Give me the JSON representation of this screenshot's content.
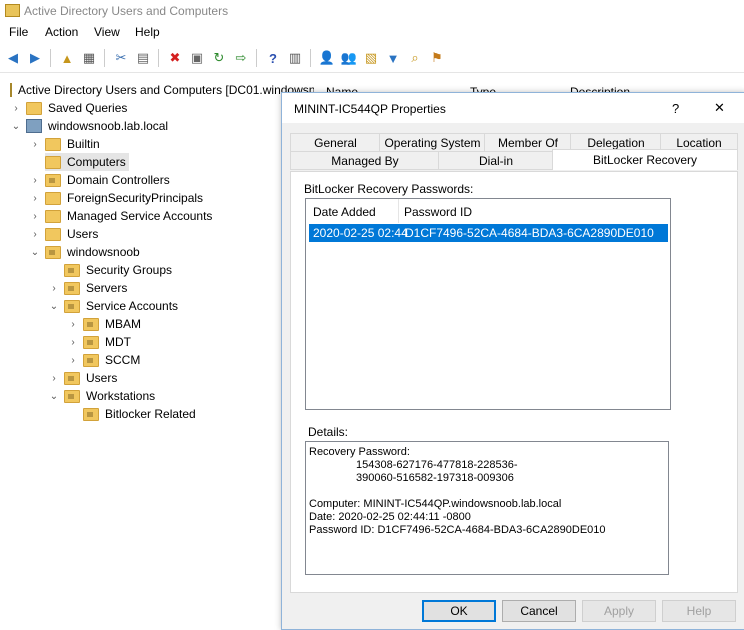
{
  "window": {
    "title": "Active Directory Users and Computers"
  },
  "menu": [
    "File",
    "Action",
    "View",
    "Help"
  ],
  "toolbar_icons": [
    "back-arrow-icon",
    "forward-arrow-icon",
    "up-folder-icon",
    "show-hide-tree-icon",
    "cut-icon",
    "clipboard-icon",
    "delete-icon",
    "properties-icon",
    "refresh-icon",
    "export-icon",
    "help-icon",
    "console-help-icon",
    "new-user-icon",
    "new-group-icon",
    "new-ou-icon",
    "filter-icon",
    "find-icon",
    "add-to-group-icon"
  ],
  "tree": {
    "root": "Active Directory Users and Computers [DC01.windowsnoob.lab.local]",
    "saved_queries": "Saved Queries",
    "domain": "windowsnoob.lab.local",
    "items": [
      {
        "label": "Builtin",
        "level": 2
      },
      {
        "label": "Computers",
        "level": 2,
        "selected": true
      },
      {
        "label": "Domain Controllers",
        "level": 2
      },
      {
        "label": "ForeignSecurityPrincipals",
        "level": 2
      },
      {
        "label": "Managed Service Accounts",
        "level": 2
      },
      {
        "label": "Users",
        "level": 2
      },
      {
        "label": "windowsnoob",
        "level": 2
      },
      {
        "label": "Security Groups",
        "level": 3
      },
      {
        "label": "Servers",
        "level": 3
      },
      {
        "label": "Service Accounts",
        "level": 3
      },
      {
        "label": "MBAM",
        "level": 4
      },
      {
        "label": "MDT",
        "level": 4
      },
      {
        "label": "SCCM",
        "level": 4
      },
      {
        "label": "Users",
        "level": 3
      },
      {
        "label": "Workstations",
        "level": 3
      },
      {
        "label": "Bitlocker Related",
        "level": 4
      }
    ]
  },
  "list_header": {
    "name": "Name",
    "type": "Type",
    "description": "Description"
  },
  "dialog": {
    "title": "MININT-IC544QP Properties",
    "help_symbol": "?",
    "close_symbol": "✕",
    "tabs_row1": [
      "General",
      "Operating System",
      "Member Of",
      "Delegation",
      "Location"
    ],
    "tabs_row2": [
      "Managed By",
      "Dial-in",
      "BitLocker Recovery"
    ],
    "active_tab": "BitLocker Recovery",
    "passwords_label": "BitLocker Recovery Passwords:",
    "columns": {
      "date": "Date Added",
      "id": "Password ID"
    },
    "rows": [
      {
        "date": "2020-02-25 02:44",
        "id": "D1CF7496-52CA-4684-BDA3-6CA2890DE010"
      }
    ],
    "details_label": "Details:",
    "details": {
      "recovery_heading": "Recovery Password:",
      "recovery_line1": "154308-627176-477818-228536-",
      "recovery_line2": "390060-516582-197318-009306",
      "computer": "Computer: MININT-IC544QP.windowsnoob.lab.local",
      "date": "Date: 2020-02-25 02:44:11 -0800",
      "password_id": "Password ID: D1CF7496-52CA-4684-BDA3-6CA2890DE010"
    },
    "buttons": {
      "ok": "OK",
      "cancel": "Cancel",
      "apply": "Apply",
      "help": "Help"
    }
  }
}
